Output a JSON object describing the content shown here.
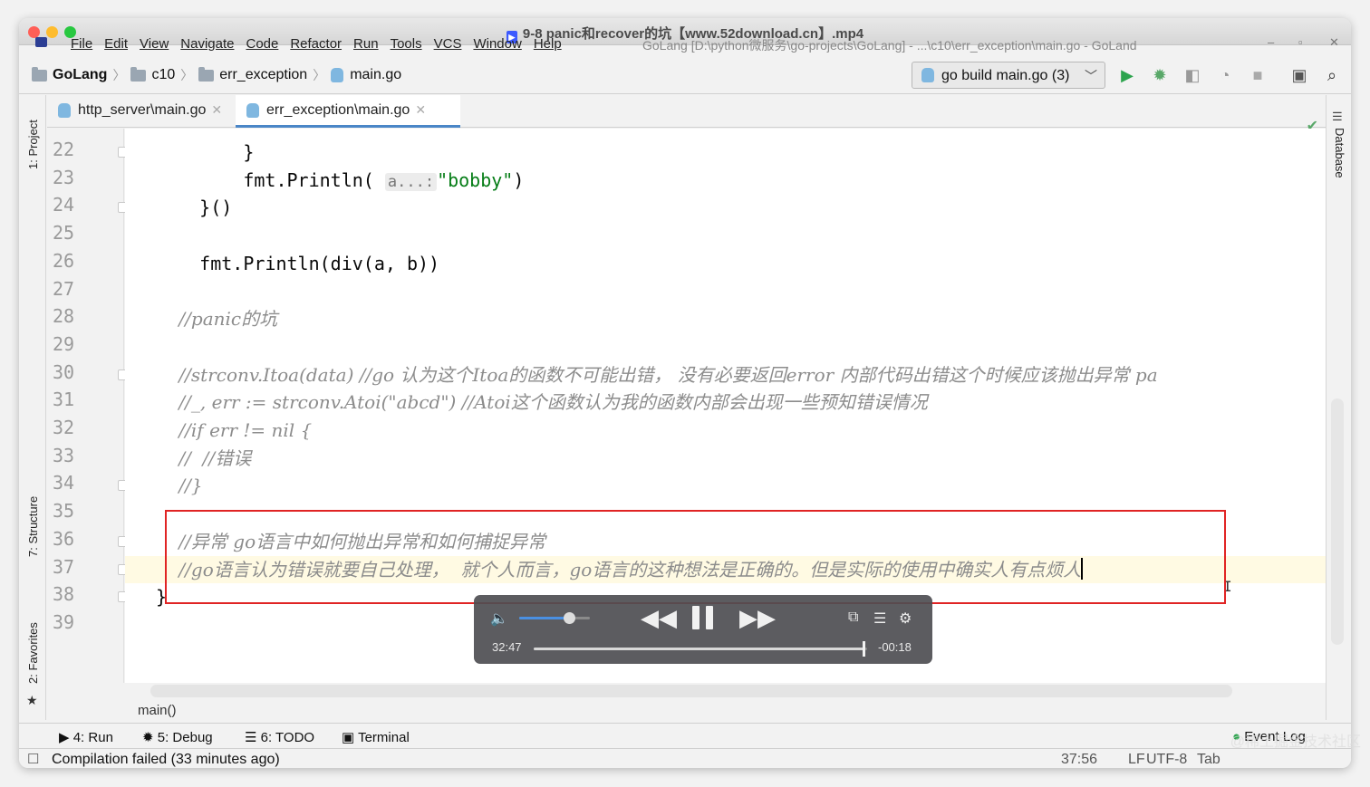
{
  "window": {
    "video_title": "9-8 panic和recover的坑【www.52download.cn】.mp4",
    "ide_title": "GoLang [D:\\python微服务\\go-projects\\GoLang] - ...\\c10\\err_exception\\main.go - GoLand"
  },
  "menu": {
    "items": [
      "File",
      "Edit",
      "View",
      "Navigate",
      "Code",
      "Refactor",
      "Run",
      "Tools",
      "VCS",
      "Window",
      "Help"
    ]
  },
  "breadcrumb": {
    "project": "GoLang",
    "folder1": "c10",
    "folder2": "err_exception",
    "file": "main.go"
  },
  "toolbar": {
    "run_config": "go build main.go (3)",
    "accent_run": "#2da44e",
    "accent_debug": "#59a869"
  },
  "side_panels": {
    "project": "1: Project",
    "structure": "7: Structure",
    "favorites": "2: Favorites",
    "database": "Database"
  },
  "tabs": [
    {
      "label": "http_server\\main.go",
      "active": false
    },
    {
      "label": "err_exception\\main.go",
      "active": true
    }
  ],
  "editor": {
    "lines": [
      {
        "no": "22",
        "code": "        }"
      },
      {
        "no": "23",
        "code_prefix": "        fmt.Println( ",
        "hint": "a...:",
        "string": "\"bobby\"",
        "code_suffix": ")"
      },
      {
        "no": "24",
        "code": "    }()"
      },
      {
        "no": "25",
        "code": ""
      },
      {
        "no": "26",
        "code": "    fmt.Println(div(a, b))"
      },
      {
        "no": "27",
        "code": ""
      },
      {
        "no": "28",
        "comment": "    //panic的坑"
      },
      {
        "no": "29",
        "code": ""
      },
      {
        "no": "30",
        "comment": "    //strconv.Itoa(data) //go 认为这个Itoa的函数不可能出错， 没有必要返回error 内部代码出错这个时候应该抛出异常 pa"
      },
      {
        "no": "31",
        "comment": "    //_, err := strconv.Atoi(\"abcd\") //Atoi这个函数认为我的函数内部会出现一些预知错误情况"
      },
      {
        "no": "32",
        "comment": "    //if err != nil {"
      },
      {
        "no": "33",
        "comment": "    //  //错误"
      },
      {
        "no": "34",
        "comment": "    //}"
      },
      {
        "no": "35",
        "code": ""
      },
      {
        "no": "36",
        "comment": "    //异常 go语言中如何抛出异常和如何捕捉异常"
      },
      {
        "no": "37",
        "comment": "    //go语言认为错误就要自己处理，  就个人而言，go语言的这种想法是正确的。但是实际的使用中确实人有点烦人"
      },
      {
        "no": "38",
        "code": "}"
      },
      {
        "no": "39",
        "code": ""
      }
    ],
    "function_breadcrumb": "main()"
  },
  "player": {
    "elapsed": "32:47",
    "remaining": "-00:18",
    "progress": 0.99,
    "volume": 0.7
  },
  "tool_windows": {
    "run": "4: Run",
    "debug": "5: Debug",
    "todo": "6: TODO",
    "terminal": "Terminal",
    "event_log": "Event Log"
  },
  "status": {
    "message": "Compilation failed (33 minutes ago)",
    "position": "37:56",
    "line_sep": "LF",
    "encoding": "UTF-8",
    "indent": "Tab"
  },
  "watermark": "@稀土掘金技术社区"
}
